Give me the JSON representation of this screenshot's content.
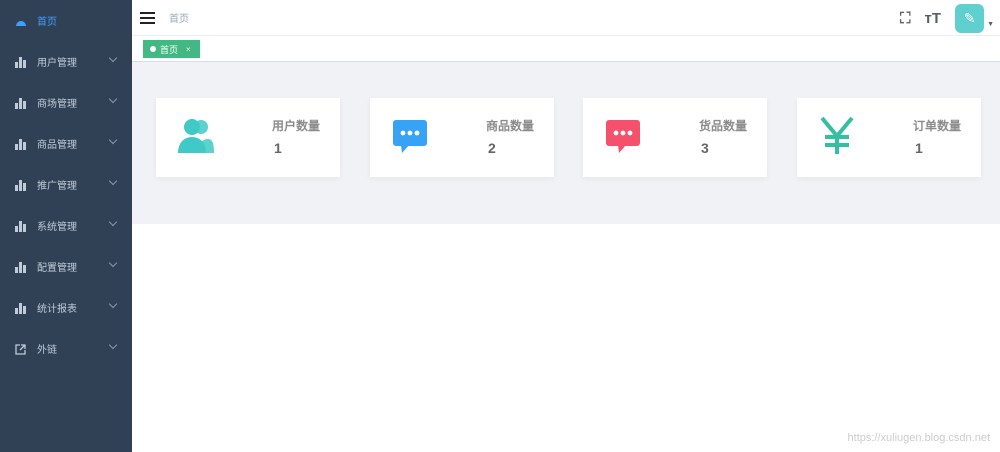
{
  "sidebar": {
    "items": [
      {
        "label": "首页",
        "icon": "dashboard-icon"
      },
      {
        "label": "用户管理",
        "icon": "chart-icon"
      },
      {
        "label": "商场管理",
        "icon": "chart-icon"
      },
      {
        "label": "商品管理",
        "icon": "chart-icon"
      },
      {
        "label": "推广管理",
        "icon": "chart-icon"
      },
      {
        "label": "系统管理",
        "icon": "chart-icon"
      },
      {
        "label": "配置管理",
        "icon": "chart-icon"
      },
      {
        "label": "统计报表",
        "icon": "chart-icon"
      },
      {
        "label": "外链",
        "icon": "external-link-icon"
      }
    ]
  },
  "header": {
    "breadcrumb": "首页",
    "fullscreen": "⛶",
    "font_size": "тT",
    "caret": "▼",
    "avatar": "✎"
  },
  "tags": [
    {
      "label": "首页",
      "close": "×"
    }
  ],
  "cards": [
    {
      "label": "用户数量",
      "value": "1",
      "color": "#40c9c6"
    },
    {
      "label": "商品数量",
      "value": "2",
      "color": "#36a3f7"
    },
    {
      "label": "货品数量",
      "value": "3",
      "color": "#f4516c"
    },
    {
      "label": "订单数量",
      "value": "1",
      "color": "#34bfa3"
    }
  ],
  "watermark": "https://xuliugen.blog.csdn.net"
}
